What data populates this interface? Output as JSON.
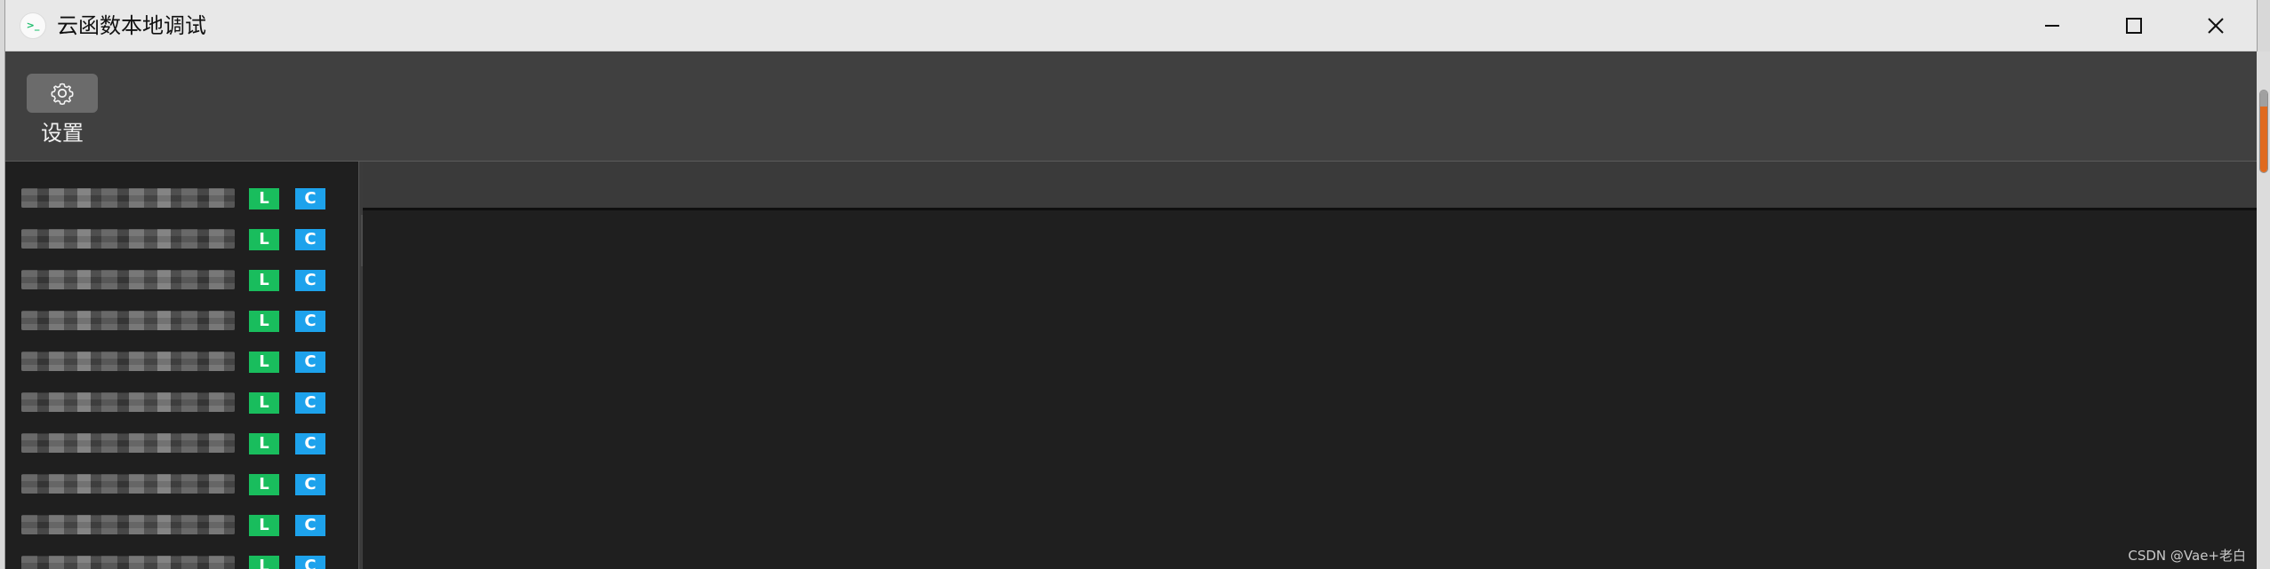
{
  "window": {
    "title": "云函数本地调试",
    "icon": "cloud-function-app-icon",
    "icon_text": ">_",
    "controls": [
      {
        "name": "minimize",
        "icon": "minimize-icon"
      },
      {
        "name": "maximize",
        "icon": "maximize-icon"
      },
      {
        "name": "close",
        "icon": "close-icon"
      }
    ]
  },
  "toolbar": {
    "settings_label": "设置",
    "settings_icon": "gear-icon"
  },
  "function_list": {
    "badges": {
      "local": "L",
      "cloud": "C"
    },
    "items": [
      {
        "state": "visible"
      },
      {
        "state": "visible"
      },
      {
        "state": "visible"
      },
      {
        "state": "visible"
      },
      {
        "state": "visible"
      },
      {
        "state": "visible"
      },
      {
        "state": "visible"
      },
      {
        "state": "visible"
      },
      {
        "state": "visible"
      },
      {
        "state": "visible"
      }
    ]
  },
  "watermark": "CSDN @Vae+老白",
  "colors": {
    "title_bar": "#e8e8e8",
    "toolbar": "#404040",
    "editor": "#1f1f1f",
    "local_badge": "#19bd5d",
    "cloud_badge": "#1da2ec",
    "scroll_accent": "#e06a1f"
  }
}
